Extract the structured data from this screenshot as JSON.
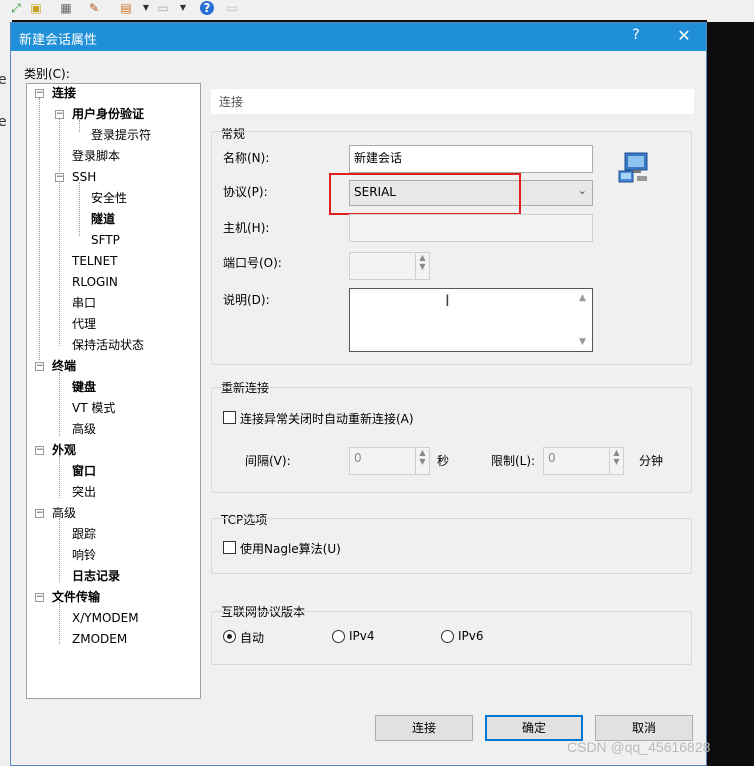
{
  "window": {
    "title": "新建会话属性",
    "help_label": "?",
    "close_label": "✕"
  },
  "category_label": "类别(C):",
  "tree": {
    "items": [
      {
        "label": "连接",
        "bold": true
      },
      {
        "label": "用户身份验证",
        "bold": true
      },
      {
        "label": "登录提示符",
        "bold": false
      },
      {
        "label": "登录脚本",
        "bold": false
      },
      {
        "label": "SSH",
        "bold": false
      },
      {
        "label": "安全性",
        "bold": false
      },
      {
        "label": "隧道",
        "bold": true
      },
      {
        "label": "SFTP",
        "bold": false
      },
      {
        "label": "TELNET",
        "bold": false
      },
      {
        "label": "RLOGIN",
        "bold": false
      },
      {
        "label": "串口",
        "bold": false
      },
      {
        "label": "代理",
        "bold": false
      },
      {
        "label": "保持活动状态",
        "bold": false
      },
      {
        "label": "终端",
        "bold": true
      },
      {
        "label": "键盘",
        "bold": true
      },
      {
        "label": "VT 模式",
        "bold": false
      },
      {
        "label": "高级",
        "bold": false
      },
      {
        "label": "外观",
        "bold": true
      },
      {
        "label": "窗口",
        "bold": true
      },
      {
        "label": "突出",
        "bold": false
      },
      {
        "label": "高级",
        "bold": false
      },
      {
        "label": "跟踪",
        "bold": false
      },
      {
        "label": "响铃",
        "bold": false
      },
      {
        "label": "日志记录",
        "bold": true
      },
      {
        "label": "文件传输",
        "bold": true
      },
      {
        "label": "X/YMODEM",
        "bold": false
      },
      {
        "label": "ZMODEM",
        "bold": false
      }
    ]
  },
  "breadcrumb": "连接",
  "general": {
    "title": "常规",
    "name_label": "名称(N):",
    "name_value": "新建会话",
    "protocol_label": "协议(P):",
    "protocol_value": "SERIAL",
    "host_label": "主机(H):",
    "host_value": "",
    "port_label": "端口号(O):",
    "port_value": "",
    "desc_label": "说明(D):",
    "desc_value": ""
  },
  "reconnect": {
    "title": "重新连接",
    "checkbox_label": "连接异常关闭时自动重新连接(A)",
    "interval_label": "间隔(V):",
    "interval_value": "0",
    "interval_unit": "秒",
    "limit_label": "限制(L):",
    "limit_value": "0",
    "limit_unit": "分钟"
  },
  "tcp": {
    "title": "TCP选项",
    "nagle_label": "使用Nagle算法(U)"
  },
  "ip_version": {
    "title": "互联网协议版本",
    "options": [
      "自动",
      "IPv4",
      "IPv6"
    ],
    "selected": "自动"
  },
  "buttons": {
    "connect": "连接",
    "ok": "确定",
    "cancel": "取消"
  },
  "watermark": "CSDN @qq_45616828",
  "bg_text": [
    "e",
    "e"
  ],
  "colors": {
    "titlebar": "#1e8fd8",
    "highlight": "#e02020",
    "default_button_border": "#0078d7"
  }
}
